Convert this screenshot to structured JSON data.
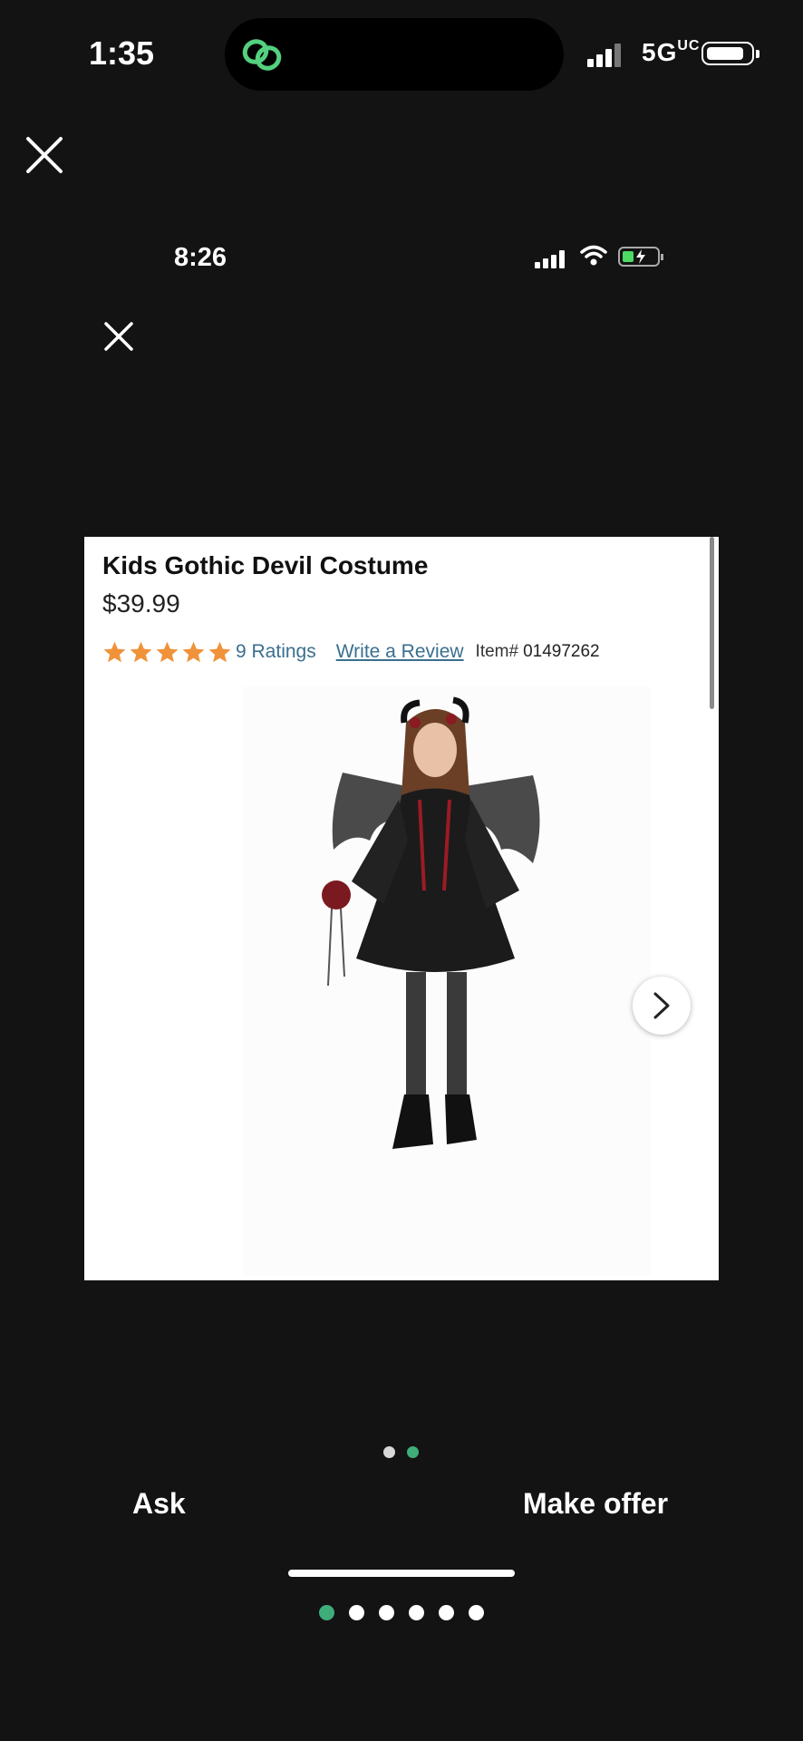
{
  "status_bar": {
    "time": "1:35",
    "network": "5G",
    "network_suffix": "UC"
  },
  "inner_status_bar": {
    "time": "8:26"
  },
  "product": {
    "title": "Kids Gothic Devil Costume",
    "price": "$39.99",
    "rating_stars": 5,
    "ratings_text": "9 Ratings",
    "write_review": "Write a Review",
    "item_label": "Item#",
    "item_number": "01497262"
  },
  "inner_pager": {
    "count": 2,
    "active": 1
  },
  "actions": {
    "ask": "Ask",
    "make_offer": "Make offer"
  },
  "outer_pager": {
    "count": 6,
    "active": 0
  },
  "colors": {
    "accent": "#3fad7a",
    "background": "#131313",
    "star": "#f0923a",
    "link": "#3a6f8f"
  }
}
